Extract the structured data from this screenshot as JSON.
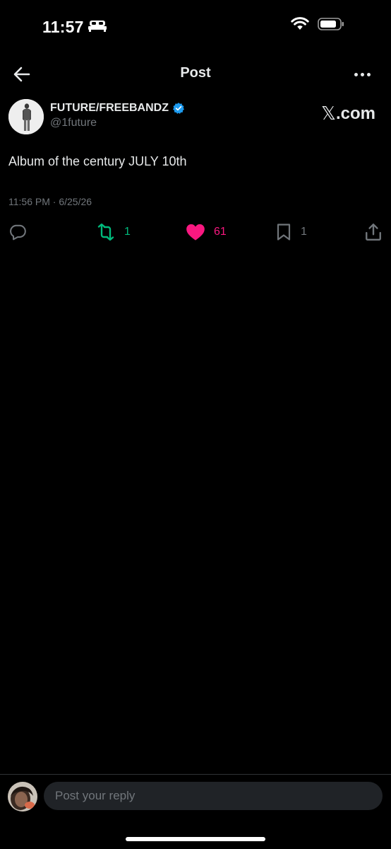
{
  "status_bar": {
    "time": "11:57",
    "sleep_icon": "bed-icon",
    "wifi_icon": "wifi-icon",
    "battery_icon": "battery-icon"
  },
  "nav": {
    "back_icon": "back-arrow-icon",
    "title": "Post",
    "more_icon": "more-horizontal-icon"
  },
  "post": {
    "author_name": "FUTURE/FREEBANDZ",
    "verified": true,
    "verified_color": "#1d9bf0",
    "author_handle": "@1future",
    "watermark_x": "𝕏",
    "watermark_domain": ".com",
    "text": "Album of the century JULY 10th",
    "timestamp": "11:56 PM · 6/25/26"
  },
  "actions": {
    "reply": {
      "icon": "reply-icon",
      "count": ""
    },
    "repost": {
      "icon": "repost-icon",
      "count": "1",
      "color": "#00ba7c"
    },
    "like": {
      "icon": "heart-icon",
      "count": "61",
      "color": "#f91880"
    },
    "bookmark": {
      "icon": "bookmark-icon",
      "count": "1"
    },
    "share": {
      "icon": "share-icon"
    }
  },
  "reply_bar": {
    "placeholder": "Post your reply"
  }
}
